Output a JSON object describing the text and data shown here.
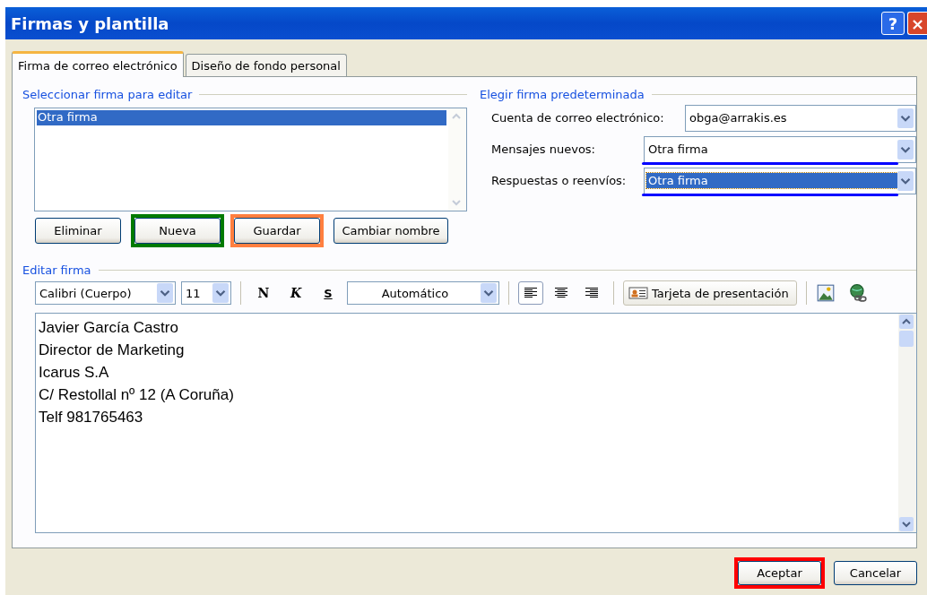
{
  "window": {
    "title": "Firmas y plantilla",
    "help": "?",
    "close": "×"
  },
  "tabs": [
    {
      "label": "Firma de correo electrónico",
      "selected": true
    },
    {
      "label": "Diseño de fondo personal",
      "selected": false
    }
  ],
  "select_group": {
    "title": "Seleccionar firma para editar",
    "items": [
      {
        "label": "Otra firma",
        "selected": true
      }
    ],
    "buttons": [
      {
        "label": "Eliminar"
      },
      {
        "label": "Nueva",
        "color": "#007a00"
      },
      {
        "label": "Guardar",
        "color": "#ff7f3f"
      },
      {
        "label": "Cambiar nombre"
      }
    ]
  },
  "default_group": {
    "title": "Elegir firma predeterminada",
    "fields": [
      {
        "label": "Cuenta de correo electrónico:",
        "value": "obga@arrakis.es",
        "selected": false,
        "marked": false
      },
      {
        "label": "Mensajes nuevos:",
        "value": "Otra firma",
        "selected": false,
        "marked": true
      },
      {
        "label": "Respuestas o reenvíos:",
        "value": "Otra firma",
        "selected": true,
        "marked": true
      }
    ]
  },
  "editor": {
    "title": "Editar firma",
    "font": "Calibri (Cuerpo)",
    "size": "11",
    "bold": "N",
    "italic": "K",
    "underline": "S",
    "color_label": "Automático",
    "align": [
      {
        "kind": "left",
        "selected": true
      },
      {
        "kind": "center",
        "selected": false
      },
      {
        "kind": "right",
        "selected": false
      }
    ],
    "card_button": "Tarjeta de presentación",
    "lines": [
      "Javier García Castro",
      "Director de Marketing",
      "Icarus S.A",
      "C/ Restollal nº 12 (A Coruña)",
      "Telf 981765463"
    ]
  },
  "footer": [
    {
      "label": "Aceptar",
      "color": "#ff0000"
    },
    {
      "label": "Cancelar"
    }
  ]
}
